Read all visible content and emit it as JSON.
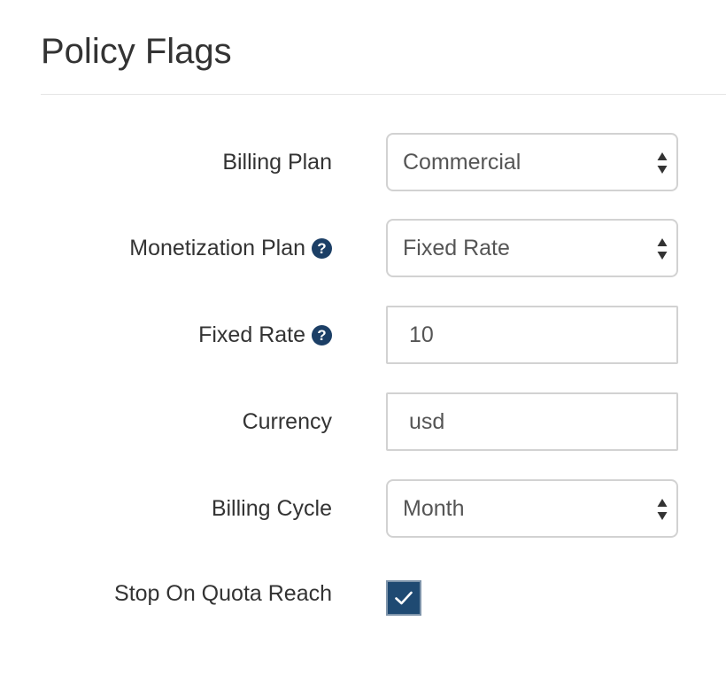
{
  "section": {
    "title": "Policy Flags"
  },
  "form": {
    "billing_plan": {
      "label": "Billing Plan",
      "value": "Commercial"
    },
    "monetization_plan": {
      "label": "Monetization Plan",
      "value": "Fixed Rate",
      "help_icon": "question-circle-icon"
    },
    "fixed_rate": {
      "label": "Fixed Rate",
      "value": "10",
      "help_icon": "question-circle-icon"
    },
    "currency": {
      "label": "Currency",
      "value": "usd"
    },
    "billing_cycle": {
      "label": "Billing Cycle",
      "value": "Month"
    },
    "stop_on_quota_reach": {
      "label": "Stop On Quota Reach",
      "checked": true,
      "icon": "checkmark-icon"
    }
  },
  "colors": {
    "accent": "#1f4a72",
    "help_icon": "#1c3f66",
    "border": "#d2d2d2",
    "divider": "#e5e5e5",
    "label_text": "#333333",
    "field_text": "#555555"
  }
}
